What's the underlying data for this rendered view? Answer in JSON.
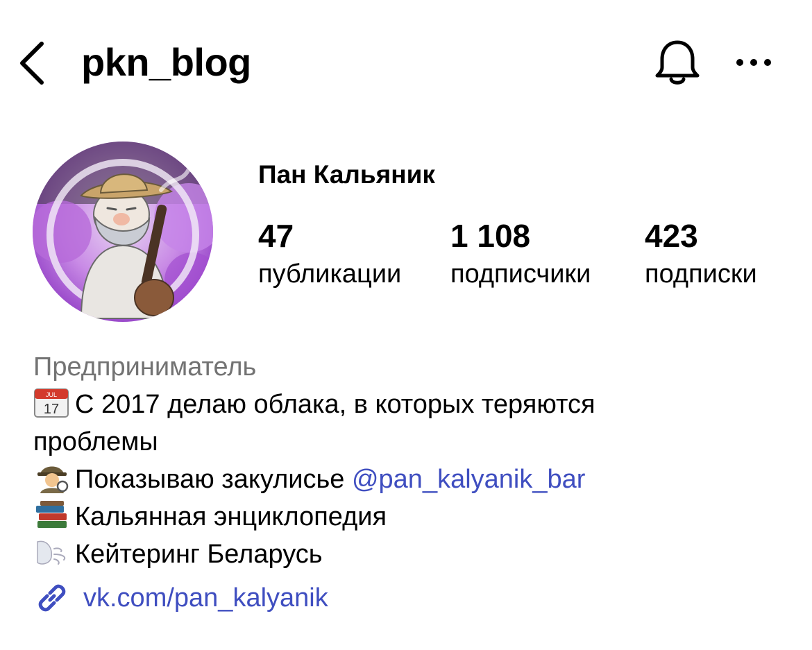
{
  "header": {
    "username": "pkn_blog",
    "back_icon": "chevron-left-icon",
    "bell_icon": "bell-icon",
    "more_icon": "more-horizontal-icon"
  },
  "profile": {
    "display_name": "Пан Кальяник",
    "avatar_icon": "avatar-illustration",
    "stats": [
      {
        "value": "47",
        "label": "публикации"
      },
      {
        "value": "1 108",
        "label": "подписчики"
      },
      {
        "value": "423",
        "label": "подписки"
      }
    ]
  },
  "bio": {
    "category": "Предприниматель",
    "lines": [
      {
        "emoji": "calendar-icon",
        "text": "С 2017 делаю облака, в которых теряются"
      },
      {
        "text": "проблемы"
      },
      {
        "emoji": "detective-icon",
        "text": "Показываю закулисье ",
        "mention": "@pan_kalyanik_bar"
      },
      {
        "emoji": "books-icon",
        "text": "Кальянная энциклопедия"
      },
      {
        "emoji": "wind-face-icon",
        "text": "Кейтеринг Беларусь"
      }
    ]
  },
  "link": {
    "icon": "link-icon",
    "text": "vk.com/pan_kalyanik"
  },
  "colors": {
    "link": "#3f4ec0",
    "muted": "#737373",
    "avatar_accent": "#b05de0"
  }
}
